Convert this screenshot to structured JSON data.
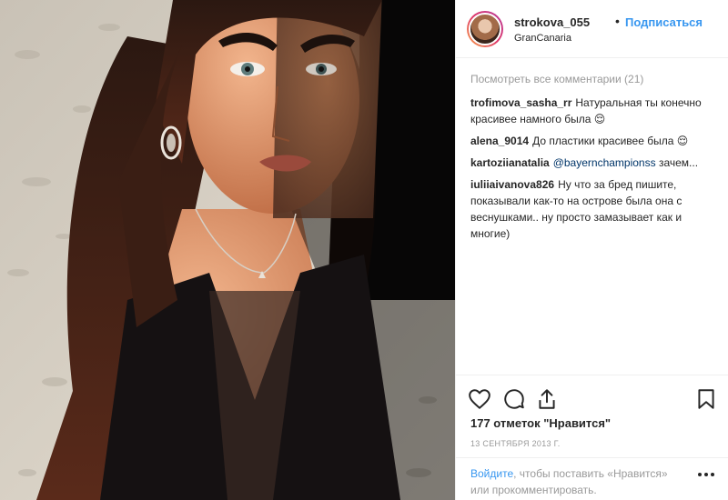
{
  "post": {
    "username": "strokova_055",
    "separator": "•",
    "follow_label": "Подписаться",
    "location": "GranCanaria",
    "view_all_comments": "Посмотреть все комментарии (21)",
    "comments": [
      {
        "user": "trofimova_sasha_rr",
        "text": "Натуральная ты конечно красивее намного была 😌"
      },
      {
        "user": "alena_9014",
        "text": "До пластики красивее была 😌"
      },
      {
        "user": "kartoziianatalia",
        "mention": "@bayernchampionss",
        "text": " зачем..."
      },
      {
        "user": "iuliiaivanova826",
        "text": "Ну что за бред пишите, показывали как-то на острове была она с веснушками.. ну просто замазывает как и многие)"
      }
    ],
    "likes_text": "177 отметок \"Нравится\"",
    "date": "13 СЕНТЯБРЯ 2013 Г.",
    "footer": {
      "login_link": "Войдите",
      "rest": ", чтобы поставить «Нравится» или прокомментировать."
    }
  },
  "icons": {
    "like": "heart-icon",
    "comment": "comment-bubble-icon",
    "share": "share-arrow-icon",
    "save": "bookmark-icon",
    "more": "ellipsis-icon"
  },
  "colors": {
    "accent": "#3897f0",
    "text": "#262626",
    "muted": "#999999",
    "mention": "#003569"
  }
}
